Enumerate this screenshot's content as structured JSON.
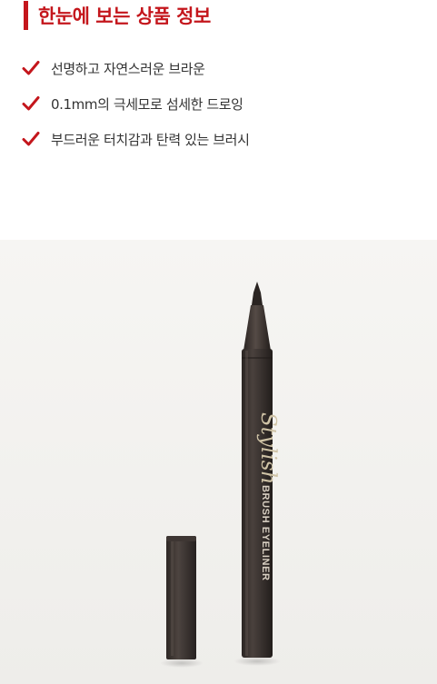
{
  "header": {
    "title": "한눈에 보는 상품 정보",
    "accent_color": "#c4161c"
  },
  "features": [
    {
      "icon": "check-icon",
      "text": "선명하고 자연스러운 브라운"
    },
    {
      "icon": "check-icon",
      "text": "0.1mm의 극세모로 섬세한 드로잉"
    },
    {
      "icon": "check-icon",
      "text": "부드러운 터치감과 탄력 있는 브러시"
    }
  ],
  "product": {
    "script_logo": "Stylish",
    "label": "BRUSH EYELINER",
    "body_color": "#3a3330"
  }
}
